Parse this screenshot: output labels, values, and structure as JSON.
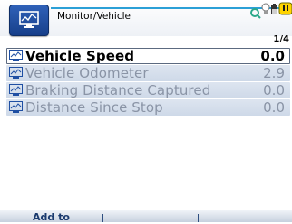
{
  "header": {
    "title": "Monitor/Vehicle",
    "page_indicator": "1/4"
  },
  "items": [
    {
      "label": "Vehicle Speed",
      "value": "0.0",
      "selected": true
    },
    {
      "label": "Vehicle Odometer",
      "value": "2.9",
      "selected": false
    },
    {
      "label": "Braking Distance Captured",
      "value": "0.0",
      "selected": false
    },
    {
      "label": "Distance Since Stop",
      "value": "0.0",
      "selected": false
    }
  ],
  "softkeys": [
    "Add to",
    "",
    ""
  ],
  "colors": {
    "accent": "#2a9fd6",
    "icon_blue": "#1f4fa3",
    "selected_text": "#000000",
    "inactive_text": "#8a94a6"
  },
  "icons": {
    "app": "monitor-icon",
    "row": "monitor-icon",
    "status": [
      "link-icon",
      "bulb-icon",
      "battery-icon",
      "warning-icon"
    ]
  }
}
